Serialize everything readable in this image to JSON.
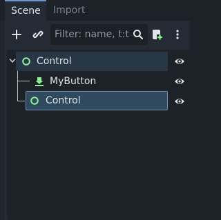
{
  "tabs": [
    {
      "label": "Scene",
      "active": true
    },
    {
      "label": "Import",
      "active": false
    }
  ],
  "toolbar": {
    "filter_placeholder": "Filter: name, t:t"
  },
  "tree": {
    "nodes": [
      {
        "label": "Control",
        "icon": "control-node-icon",
        "expanded": true,
        "visible": true
      },
      {
        "label": "MyButton",
        "icon": "instanced-scene-icon",
        "visible": true
      },
      {
        "label": "Control",
        "icon": "control-node-icon",
        "selected": true,
        "visible": true
      }
    ]
  },
  "colors": {
    "accent": "#6c95c9",
    "control_node_green": "#8eef97",
    "selection": "#2f4a5e"
  }
}
